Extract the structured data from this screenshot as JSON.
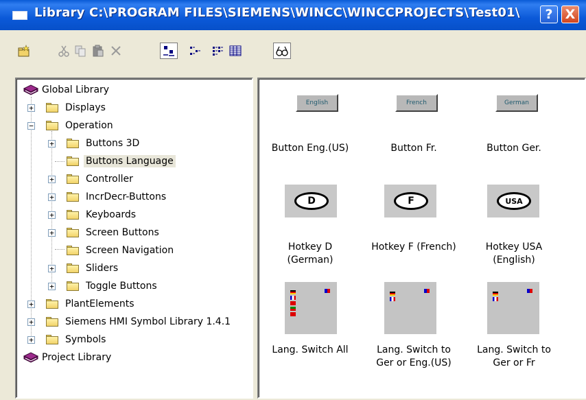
{
  "window": {
    "title": "Library  C:\\PROGRAM FILES\\SIEMENS\\WINCC\\WINCCPROJECTS\\Test01\\",
    "help_label": "?",
    "close_label": "X"
  },
  "toolbar": {
    "icons": [
      "new-folder-icon",
      "cut-icon",
      "copy-icon",
      "paste-icon",
      "delete-icon",
      "large-icons-view-icon",
      "small-icons-view-icon",
      "list-view-icon",
      "details-view-icon",
      "preview-icon"
    ]
  },
  "tree": {
    "global_library": "Global Library",
    "displays": "Displays",
    "operation": "Operation",
    "buttons_3d": "Buttons 3D",
    "buttons_language": "Buttons Language",
    "controller": "Controller",
    "incrdecr": "IncrDecr-Buttons",
    "keyboards": "Keyboards",
    "screen_buttons": "Screen Buttons",
    "screen_navigation": "Screen Navigation",
    "sliders": "Sliders",
    "toggle_buttons": "Toggle Buttons",
    "plant_elements": "PlantElements",
    "siemens_hmi": "Siemens HMI Symbol Library 1.4.1",
    "symbols": "Symbols",
    "project_library": "Project Library",
    "expand_glyph": "+",
    "collapse_glyph": "−"
  },
  "items": {
    "btn_eng_thumb": "English",
    "btn_fr_thumb": "French",
    "btn_ger_thumb": "German",
    "btn_eng_label": "Button Eng.(US)",
    "btn_fr_label": "Button Fr.",
    "btn_ger_label": "Button Ger.",
    "hk_d_thumb": "D",
    "hk_f_thumb": "F",
    "hk_usa_thumb": "USA",
    "hk_d_label1": "Hotkey D",
    "hk_d_label2": "(German)",
    "hk_f_label1": "Hotkey F (French)",
    "hk_usa_label1": "Hotkey USA",
    "hk_usa_label2": "(English)",
    "ls_all_label1": "Lang. Switch All",
    "ls_gereng_label1": "Lang. Switch to",
    "ls_gereng_label2": "Ger or Eng.(US)",
    "ls_gerfr_label1": "Lang. Switch to",
    "ls_gerfr_label2": "Ger or Fr"
  },
  "colors": {
    "titlebar": "#0b59d8",
    "selection": "#e8e6d9",
    "folder": "#f2d36a"
  }
}
